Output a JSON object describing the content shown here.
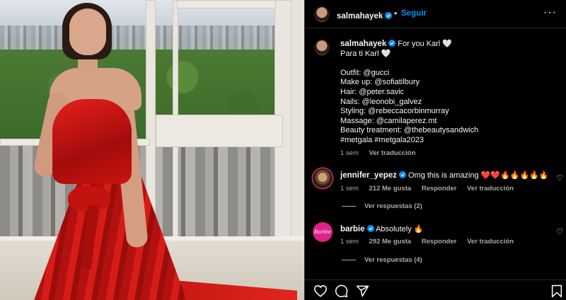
{
  "post": {
    "username": "salmahayek",
    "follow_label": "Seguir",
    "separator": "•",
    "more_label": "···",
    "caption_lines": [
      "For you Karl 🤍",
      "Para ti Karl 🤍",
      "",
      "Outfit: @gucci",
      "Make up: @sofiatilbury",
      "Hair: @peter.savic",
      "Nails: @leonobi_galvez",
      "Styling: @rebeccacorbinmurray",
      "Massage: @camilaperez.mt",
      "Beauty treatment: @thebeautysandwich",
      "#metgala #metgala2023"
    ],
    "caption_time": "1 sem",
    "caption_translate": "Ver traducción"
  },
  "comments": [
    {
      "username": "jennifer_yepez",
      "text": "Omg this is amazing ❤️❤️🔥🔥🔥🔥🔥",
      "time": "1 sem",
      "likes": "212 Me gusta",
      "reply": "Responder",
      "translate": "Ver traducción",
      "replies": "Ver respuestas (2)"
    },
    {
      "username": "barbie",
      "avatar_text": "Barbie",
      "text": "Absolutely 🔥",
      "time": "1 sem",
      "likes": "292 Me gusta",
      "reply": "Responder",
      "translate": "Ver traducción",
      "replies": "Ver respuestas (4)"
    }
  ],
  "icons": {
    "verified": "verified-badge-icon",
    "like": "heart-icon",
    "comment": "comment-icon",
    "share": "send-icon",
    "save": "bookmark-icon",
    "more": "more-icon"
  },
  "colors": {
    "accent": "#0095f6",
    "background": "#000000",
    "muted_text": "#a8a8a8",
    "dress_red": "#d71c18"
  }
}
